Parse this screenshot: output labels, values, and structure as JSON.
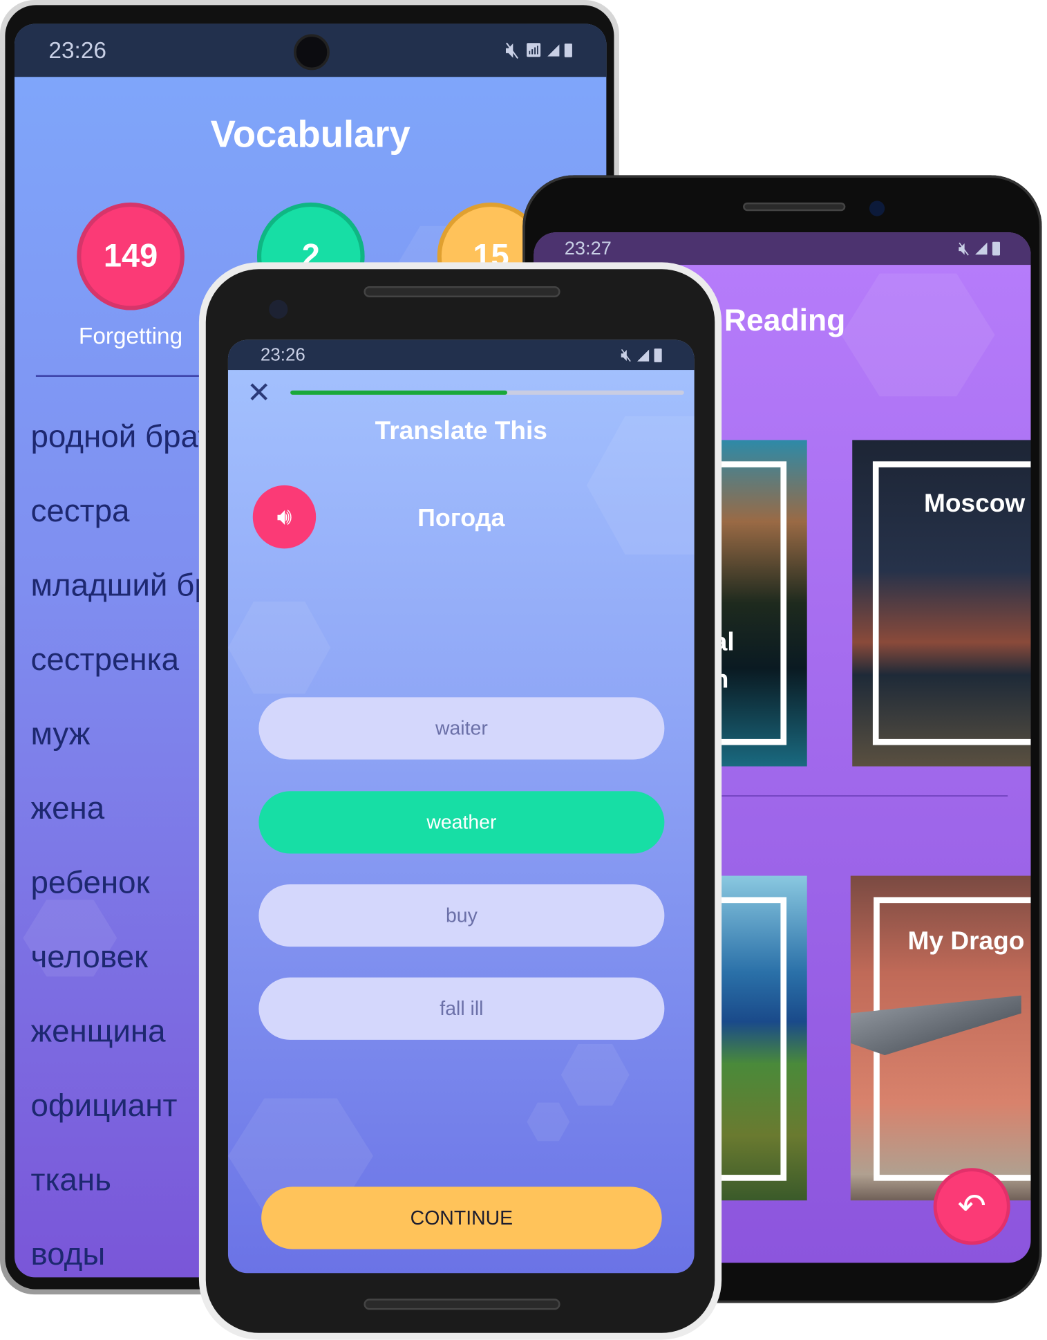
{
  "vocabulary_phone": {
    "status": {
      "time": "23:26"
    },
    "title": "Vocabulary",
    "stats": [
      {
        "value": "149",
        "label": "Forgetting",
        "color": "#fb3a76"
      },
      {
        "value": "2",
        "color": "#17dea5"
      },
      {
        "value": "15",
        "color": "#ffc25a"
      }
    ],
    "words": [
      "родной брат",
      "сестра",
      "младший брат",
      "сестренка",
      "муж",
      "жена",
      "ребенок",
      "человек",
      "женщина",
      "официант",
      "ткань",
      "воды"
    ]
  },
  "reading_phone": {
    "status": {
      "time": "23:27"
    },
    "title": "Reading",
    "cards": [
      {
        "title": "al\nn"
      },
      {
        "title": "Moscow"
      },
      {
        "title": ""
      },
      {
        "title": "My Drago"
      }
    ],
    "fab_icon": "undo-arrow-icon"
  },
  "quiz_phone": {
    "status": {
      "time": "23:26"
    },
    "close_icon": "close-icon",
    "progress": 0.55,
    "title": "Translate This",
    "prompt_word": "Погода",
    "options": [
      {
        "label": "waiter",
        "selected": false
      },
      {
        "label": "weather",
        "selected": true
      },
      {
        "label": "buy",
        "selected": false
      },
      {
        "label": "fall ill",
        "selected": false
      }
    ],
    "continue_label": "CONTINUE",
    "colors": {
      "accent": "#17dea5",
      "speaker": "#fb3a76",
      "continue": "#ffc35a",
      "progress": "#1aa83a"
    }
  }
}
